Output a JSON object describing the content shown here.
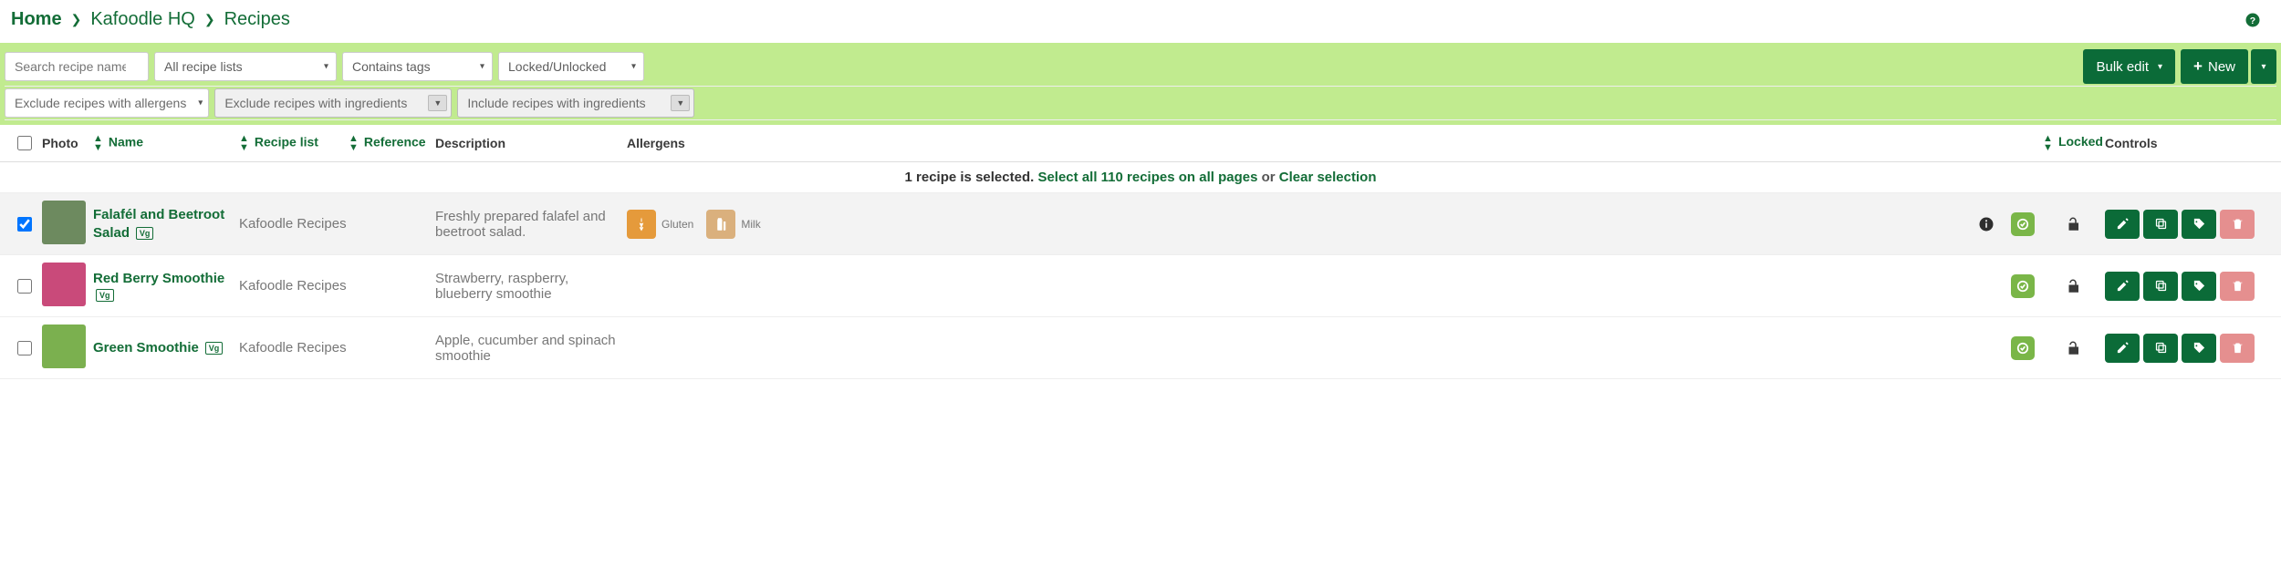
{
  "breadcrumb": {
    "home": "Home",
    "org": "Kafoodle HQ",
    "page": "Recipes"
  },
  "filters": {
    "search_placeholder": "Search recipe name/refe",
    "lists": "All recipe lists",
    "tags": "Contains tags",
    "locked": "Locked/Unlocked",
    "exclude_allergens": "Exclude recipes with allergens",
    "exclude_ingredients": "Exclude recipes with ingredients",
    "include_ingredients": "Include recipes with ingredients"
  },
  "buttons": {
    "bulk_edit": "Bulk edit",
    "new": "New"
  },
  "headers": {
    "photo": "Photo",
    "name": "Name",
    "recipe_list": "Recipe list",
    "reference": "Reference",
    "description": "Description",
    "allergens": "Allergens",
    "locked": "Locked",
    "controls": "Controls"
  },
  "selection": {
    "count_text": "1 recipe is selected.",
    "select_all": "Select all 110 recipes on all pages",
    "or": "or",
    "clear": "Clear selection"
  },
  "rows": [
    {
      "selected": true,
      "name": "Falafél and Beetroot Salad",
      "diet": "Vg",
      "list": "Kafoodle Recipes",
      "desc": "Freshly prepared falafel and beetroot salad.",
      "allergens": [
        {
          "name": "Gluten",
          "icon": "gluten"
        },
        {
          "name": "Milk",
          "icon": "milk"
        }
      ],
      "info": true,
      "photo": "#6d8a5f",
      "locked": false
    },
    {
      "selected": false,
      "name": "Red Berry Smoothie",
      "diet": "Vg",
      "list": "Kafoodle Recipes",
      "desc": "Strawberry, raspberry, blueberry smoothie",
      "allergens": [],
      "info": false,
      "photo": "#c94a7a",
      "locked": false
    },
    {
      "selected": false,
      "name": "Green Smoothie",
      "diet": "Vg",
      "list": "Kafoodle Recipes",
      "desc": "Apple, cucumber and spinach smoothie",
      "allergens": [],
      "info": false,
      "photo": "#7bb04f",
      "locked": false
    }
  ]
}
